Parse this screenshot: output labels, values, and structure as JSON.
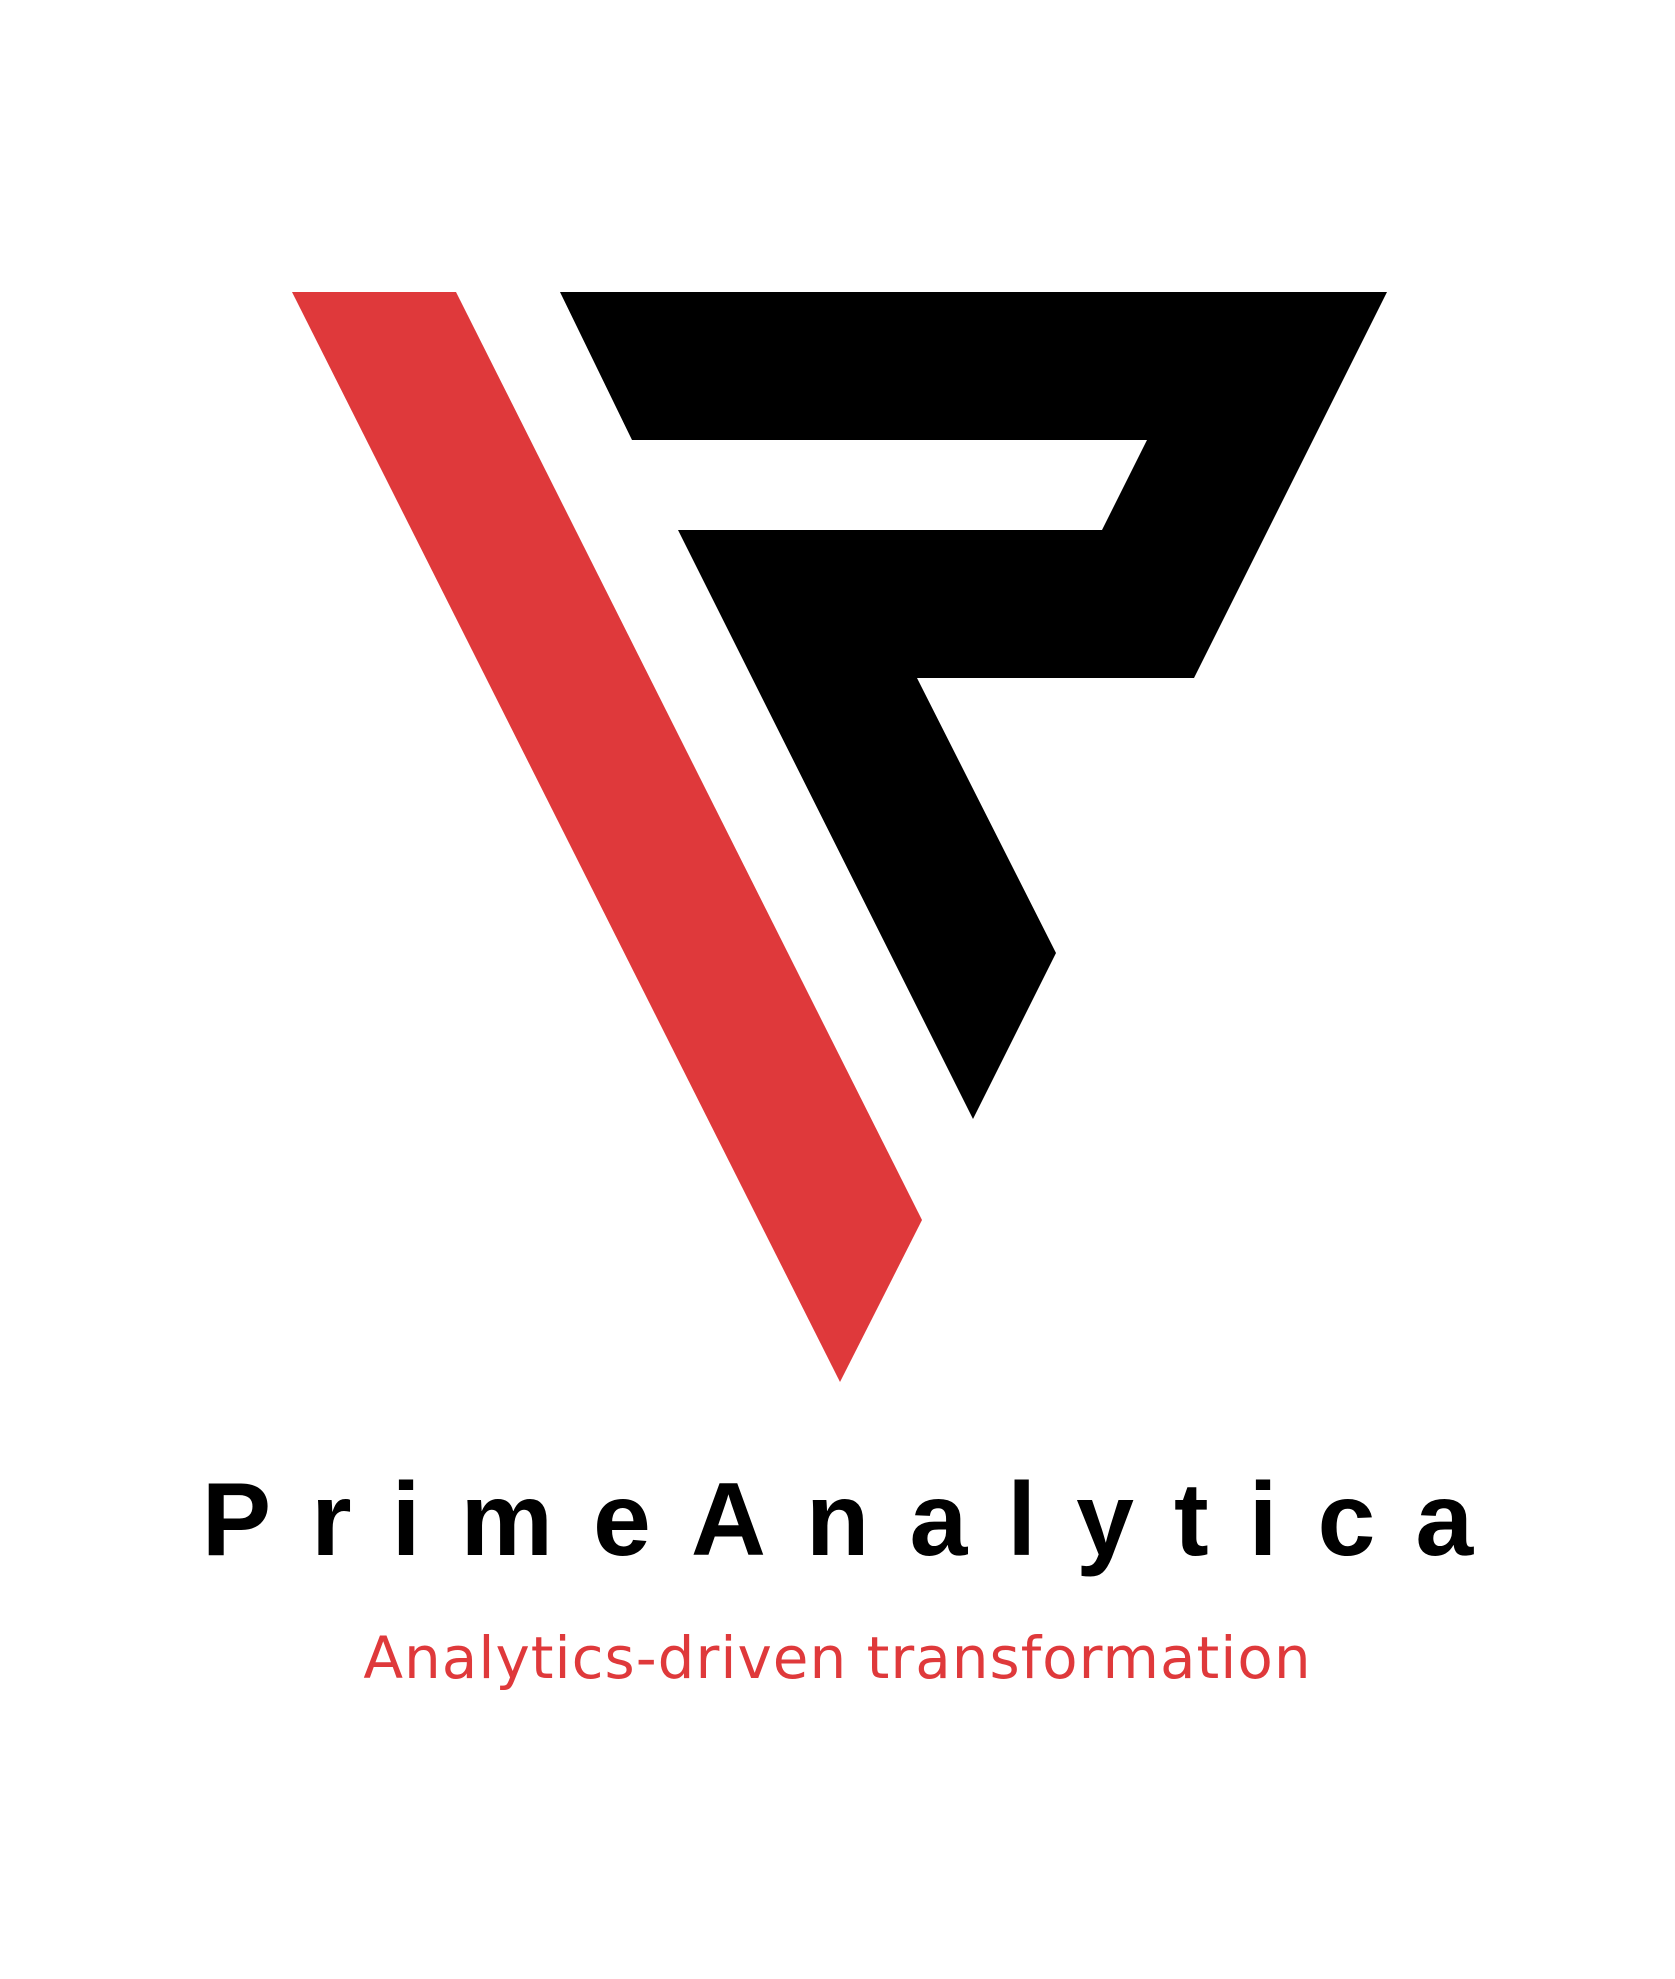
{
  "brand": {
    "name": "PrimeAnalytica",
    "tagline": "Analytics-driven transformation"
  },
  "colors": {
    "background": "#ffffff",
    "accent_red": "#DF393B",
    "mark_black": "#000000",
    "name_text": "#000000",
    "tagline_text": "#DF393B"
  },
  "logo": {
    "mark_icon": "red-stroke-and-black-p-triangle-icon"
  }
}
